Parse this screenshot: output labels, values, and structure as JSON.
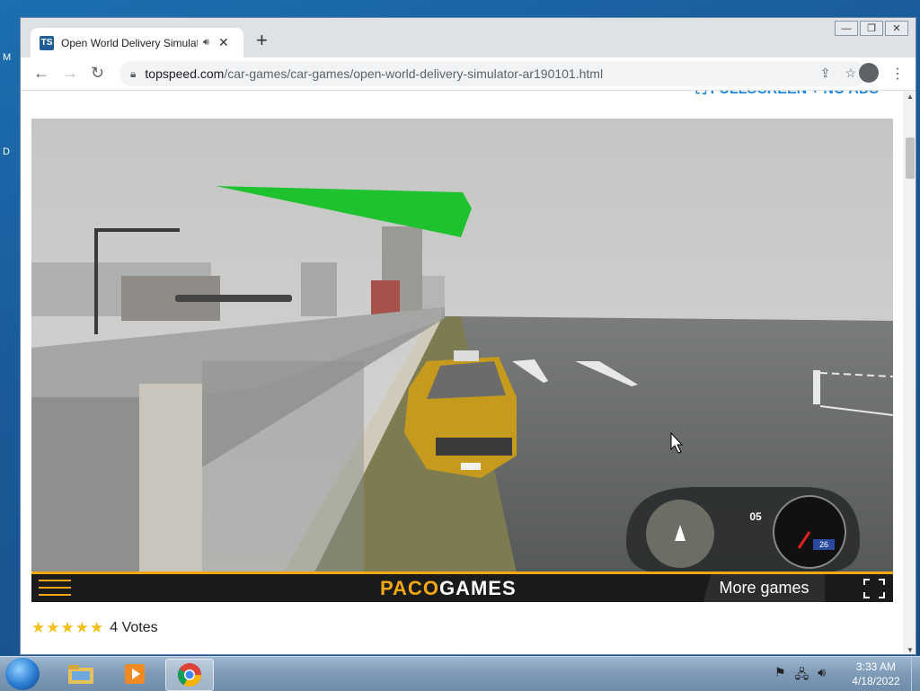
{
  "desktop": {
    "left_letters": [
      "M",
      "D"
    ]
  },
  "browser": {
    "tab_title": "Open World Delivery Simulator",
    "tab_favicon_text": "TS",
    "new_tab_label": "+",
    "window_controls": [
      "—",
      "❐",
      "✕"
    ],
    "url_domain": "topspeed.com",
    "url_path": "/car-games/car-games/open-world-delivery-simulator-ar190101.html"
  },
  "page": {
    "fullscreen_link": "⛶ FULLSCREEN + NO ADS",
    "game": {
      "brand_left": "PACO",
      "brand_right": "GAMES",
      "more_games_label": "More games",
      "hud_gear": "05",
      "hud_speed": "26"
    },
    "rating": {
      "stars": 5,
      "votes_label": "4 Votes"
    }
  },
  "taskbar": {
    "apps": [
      "file-explorer",
      "media-player",
      "chrome"
    ],
    "time": "3:33 AM",
    "date": "4/18/2022"
  },
  "colors": {
    "accent": "#f3a712",
    "link": "#1e88d8",
    "arrow_green": "#1ec12e"
  }
}
